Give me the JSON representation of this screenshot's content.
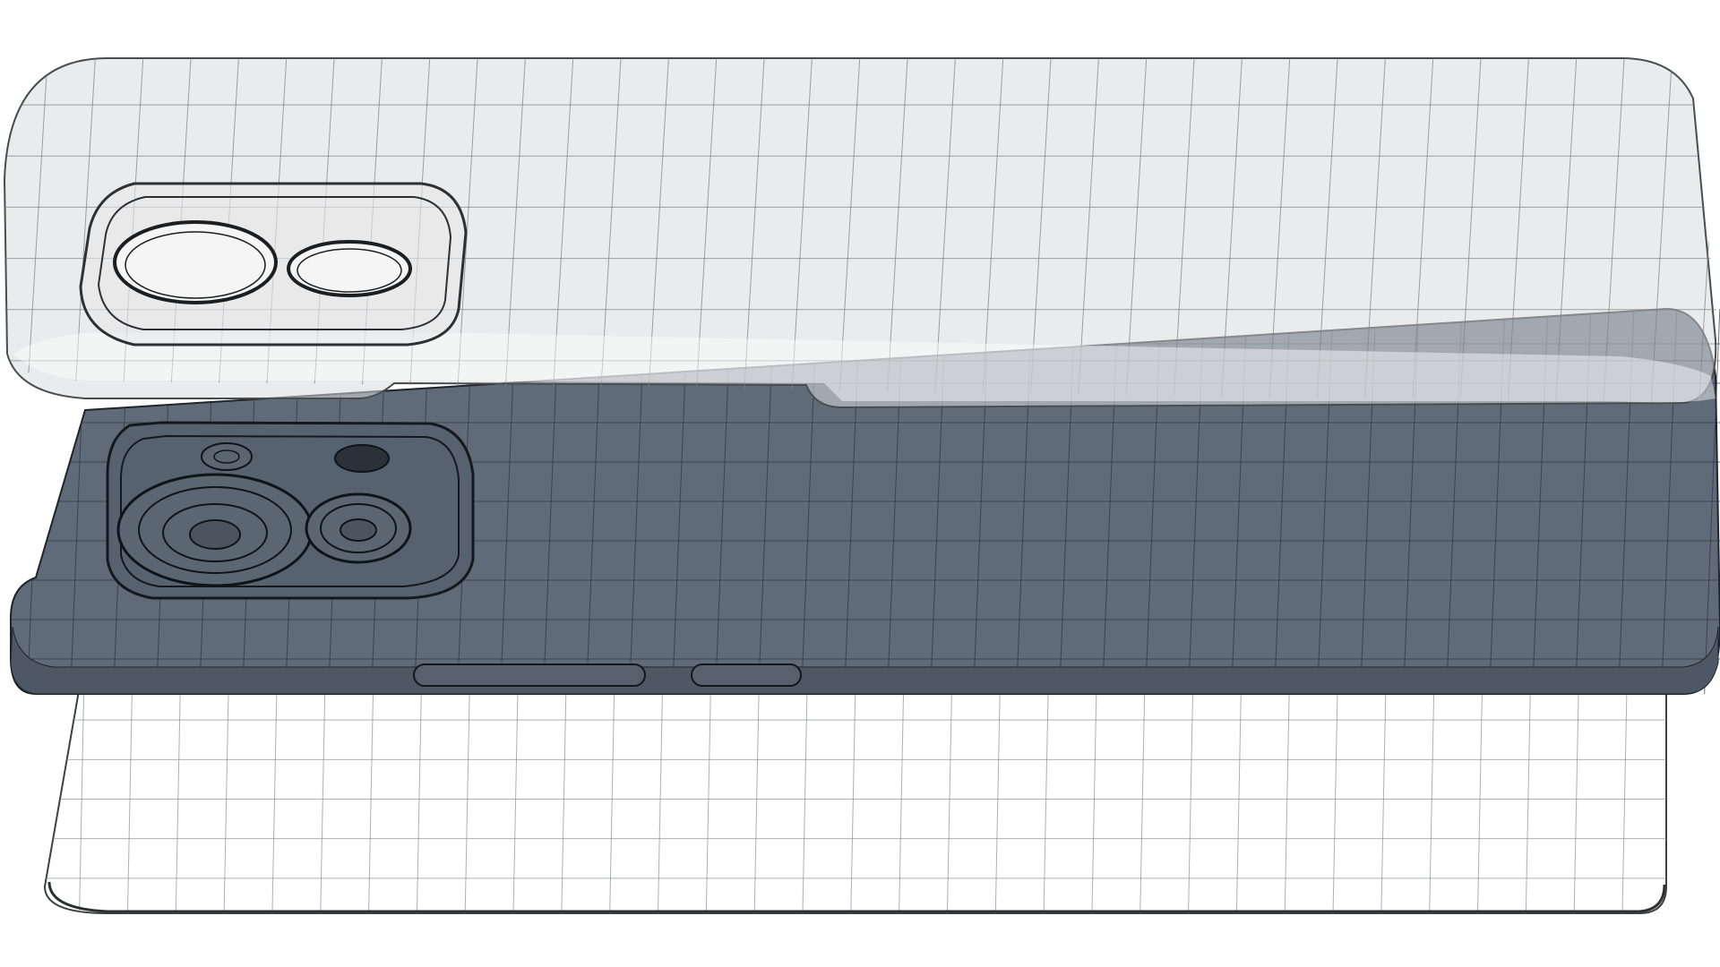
{
  "scene": {
    "background_color": "#ffffff",
    "render_style": "wireframe-over-shaded",
    "parts": [
      {
        "id": "back-cover-top-transparent",
        "fill": "#d9dbdd",
        "fill_opacity": 0.55,
        "edge_color": "#4a4d50",
        "grid_color": "#7b7f83",
        "camera_module": "two-lens",
        "icon": "phone-back-cover-icon"
      },
      {
        "id": "phone-body-middle-shaded",
        "fill": "#5f6b78",
        "fill_opacity": 1,
        "edge_color": "#1f242a",
        "grid_color": "#2c333b",
        "camera_module": "two-lens-plus-flash-and-sensor",
        "side_buttons": 2,
        "icon": "phone-body-icon"
      },
      {
        "id": "screen-bottom-transparent",
        "fill": "#ffffff",
        "fill_opacity": 0.5,
        "edge_color": "#3d4043",
        "grid_color": "#8a8d90",
        "icon": "phone-screen-icon"
      }
    ]
  }
}
